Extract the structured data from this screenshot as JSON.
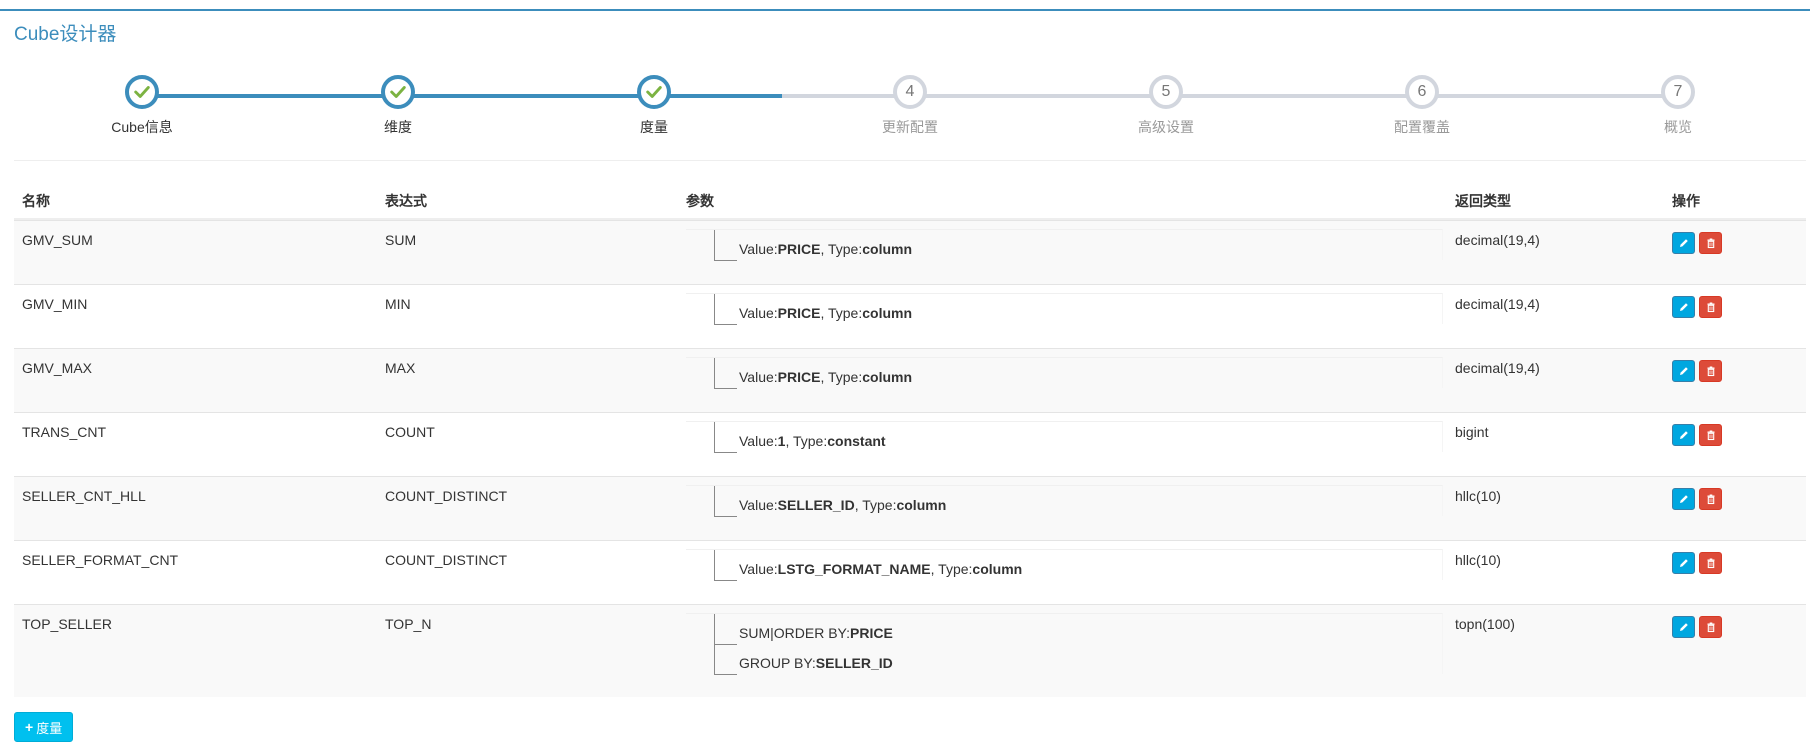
{
  "panel": {
    "title": "Cube设计器"
  },
  "wizard": {
    "steps": [
      {
        "label": "Cube信息",
        "number": "1",
        "status": "done"
      },
      {
        "label": "维度",
        "number": "2",
        "status": "done"
      },
      {
        "label": "度量",
        "number": "3",
        "status": "done"
      },
      {
        "label": "更新配置",
        "number": "4",
        "status": "pending"
      },
      {
        "label": "高级设置",
        "number": "5",
        "status": "pending"
      },
      {
        "label": "配置覆盖",
        "number": "6",
        "status": "pending"
      },
      {
        "label": "概览",
        "number": "7",
        "status": "pending"
      }
    ]
  },
  "table": {
    "headers": {
      "name": "名称",
      "expression": "表达式",
      "parameters": "参数",
      "return_type": "返回类型",
      "actions": "操作"
    },
    "rows": [
      {
        "name": "GMV_SUM",
        "expression": "SUM",
        "return_type": "decimal(19,4)",
        "params": [
          {
            "k1": "Value:",
            "v1": "PRICE",
            "k2": ", Type:",
            "v2": "column"
          }
        ]
      },
      {
        "name": "GMV_MIN",
        "expression": "MIN",
        "return_type": "decimal(19,4)",
        "params": [
          {
            "k1": "Value:",
            "v1": "PRICE",
            "k2": ", Type:",
            "v2": "column"
          }
        ]
      },
      {
        "name": "GMV_MAX",
        "expression": "MAX",
        "return_type": "decimal(19,4)",
        "params": [
          {
            "k1": "Value:",
            "v1": "PRICE",
            "k2": ", Type:",
            "v2": "column"
          }
        ]
      },
      {
        "name": "TRANS_CNT",
        "expression": "COUNT",
        "return_type": "bigint",
        "params": [
          {
            "k1": "Value:",
            "v1": "1",
            "k2": ", Type:",
            "v2": "constant"
          }
        ]
      },
      {
        "name": "SELLER_CNT_HLL",
        "expression": "COUNT_DISTINCT",
        "return_type": "hllc(10)",
        "params": [
          {
            "k1": "Value:",
            "v1": "SELLER_ID",
            "k2": ", Type:",
            "v2": "column"
          }
        ]
      },
      {
        "name": "SELLER_FORMAT_CNT",
        "expression": "COUNT_DISTINCT",
        "return_type": "hllc(10)",
        "params": [
          {
            "k1": "Value:",
            "v1": "LSTG_FORMAT_NAME",
            "k2": ", Type:",
            "v2": "column"
          }
        ]
      },
      {
        "name": "TOP_SELLER",
        "expression": "TOP_N",
        "return_type": "topn(100)",
        "params": [
          {
            "k1": "SUM|ORDER BY:",
            "v1": "PRICE",
            "k2": "",
            "v2": ""
          },
          {
            "k1": "GROUP BY:",
            "v1": "SELLER_ID",
            "k2": "",
            "v2": ""
          }
        ]
      }
    ]
  },
  "add_button": {
    "label": "度量"
  },
  "icons": {
    "check": "check-icon",
    "edit": "pencil-icon",
    "delete": "trash-icon",
    "add": "plus-icon"
  },
  "colors": {
    "accent": "#3c8dbc",
    "edit_button": "#00a7e0",
    "delete_button": "#dd4b39",
    "add_button": "#00c0ef",
    "check": "#7cb342"
  }
}
